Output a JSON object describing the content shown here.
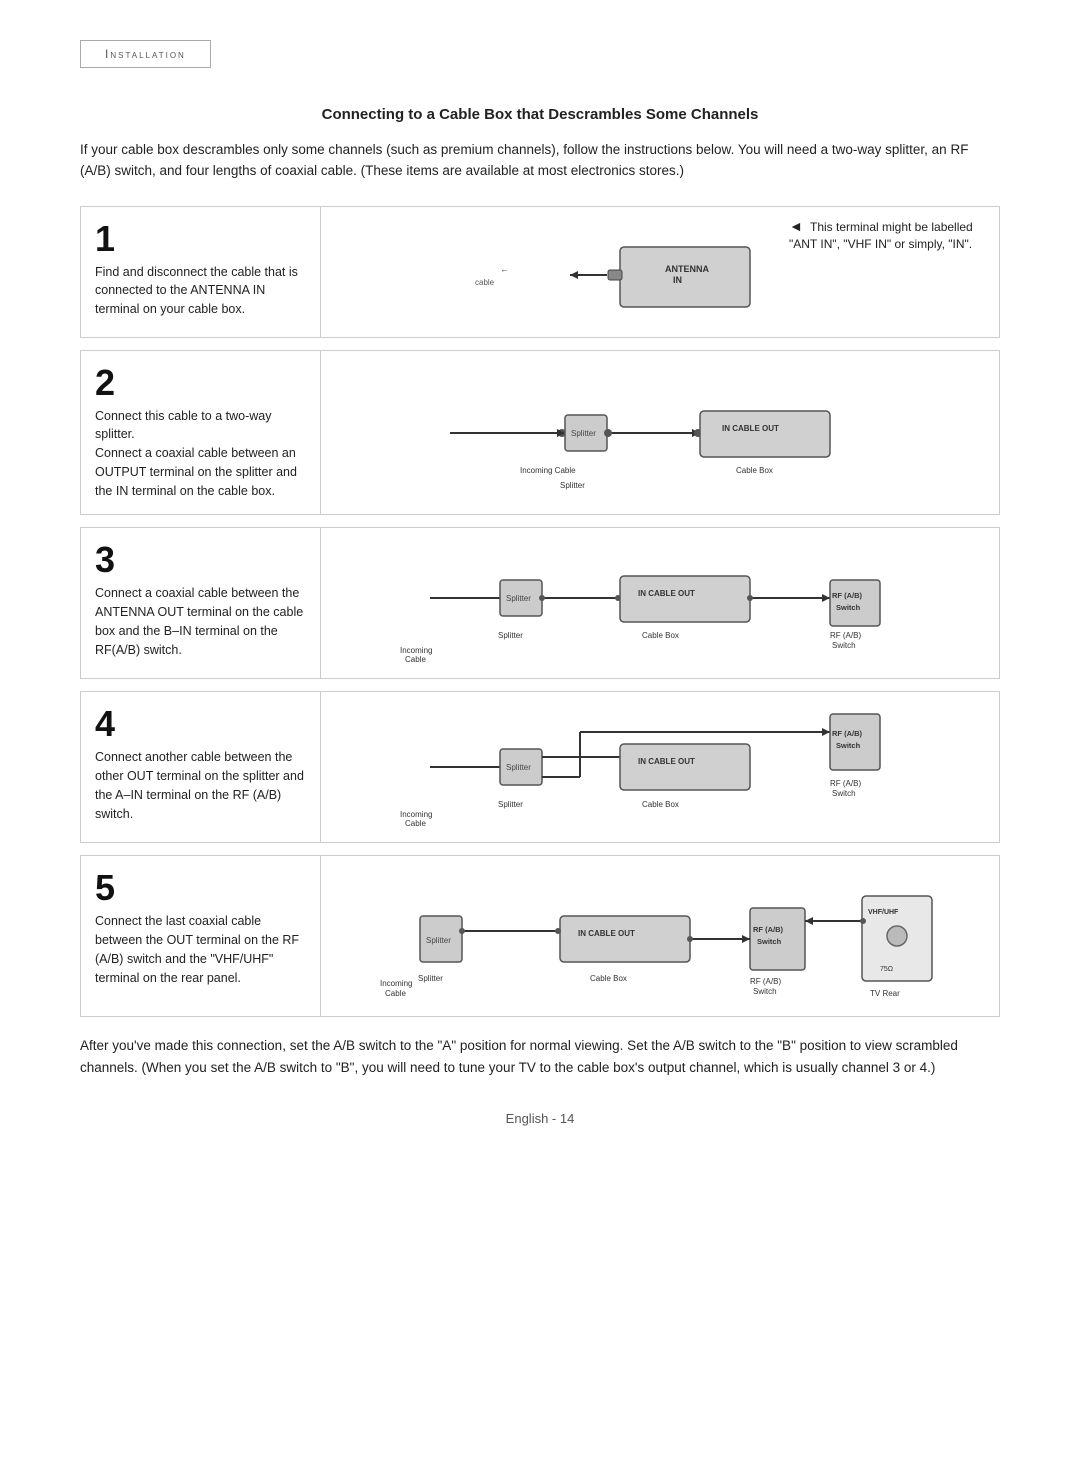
{
  "header": {
    "label": "Installation"
  },
  "section": {
    "title": "Connecting to a Cable Box that Descrambles Some Channels",
    "intro": "If your cable box descrambles only some channels (such as premium channels), follow the instructions below. You will need a two-way splitter, an RF (A/B) switch, and four lengths of coaxial cable. (These items are available at most electronics stores.)"
  },
  "note": {
    "arrow": "◄",
    "text": "This terminal might be labelled \"ANT IN\", \"VHF IN\" or simply, \"IN\"."
  },
  "steps": [
    {
      "number": "1",
      "text": "Find and disconnect the cable that is connected to the ANTENNA IN terminal on your cable box."
    },
    {
      "number": "2",
      "text": "Connect this cable to a two-way splitter.\nConnect a coaxial cable between an OUTPUT terminal on the splitter and the IN terminal on the cable box."
    },
    {
      "number": "3",
      "text": "Connect a coaxial cable between the ANTENNA OUT terminal on the cable box and the B–IN terminal on the RF(A/B) switch."
    },
    {
      "number": "4",
      "text": "Connect another cable between the other OUT terminal on the splitter and the A–IN terminal on the RF (A/B) switch."
    },
    {
      "number": "5",
      "text": "Connect the last coaxial cable between the OUT terminal on the RF (A/B) switch and the \"VHF/UHF\" terminal on the rear panel."
    }
  ],
  "footer": {
    "text": "After you've made this connection, set the A/B switch to the \"A\" position for normal viewing. Set the A/B switch to the \"B\" position to view scrambled channels. (When you set the A/B switch to \"B\", you will need to tune your TV to the cable box's output channel, which is usually channel 3 or 4.)"
  },
  "page_number": "English - 14"
}
